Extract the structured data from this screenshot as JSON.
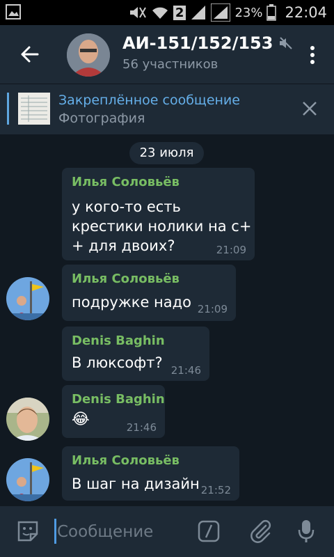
{
  "status_bar": {
    "battery": "23%",
    "sim": "2",
    "time": "22:04"
  },
  "header": {
    "title": "АИ-151/152/153",
    "subtitle": "56 участников"
  },
  "pinned": {
    "title": "Закреплённое сообщение",
    "subtitle": "Фотография"
  },
  "date_divider": "23 июля",
  "messages": [
    {
      "author": "Илья Соловьёв",
      "text": "у кого-то есть\nкрестики нолики на с+\n+ для двоих?",
      "time": "21:09"
    },
    {
      "author": "Илья Соловьёв",
      "text": "подружке надо",
      "time": "21:09"
    },
    {
      "author": "Denis Baghin",
      "text": "В люксофт?",
      "time": "21:46"
    },
    {
      "author": "Denis Baghin",
      "text": "😂",
      "time": "21:46"
    },
    {
      "author": "Илья Соловьёв",
      "text": "В шаг на дизайн",
      "time": "21:52"
    }
  ],
  "composer": {
    "placeholder": "Сообщение"
  },
  "colors": {
    "background": "#111921",
    "panel": "#1e2a36",
    "author": "#78bd63",
    "link": "#65afe9"
  }
}
